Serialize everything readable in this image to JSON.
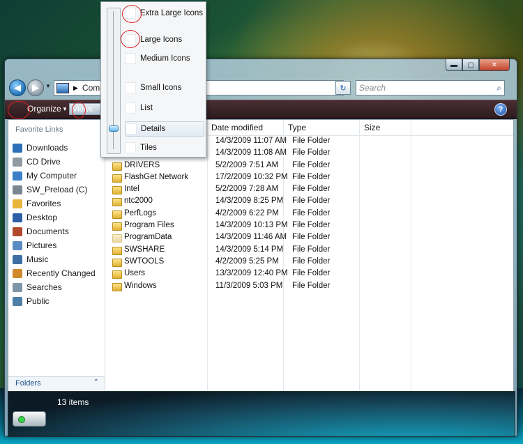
{
  "window": {
    "caption_buttons": {
      "minimize": "▬",
      "maximize": "▢",
      "close": "✕"
    }
  },
  "nav": {
    "address_crumb": "Comp",
    "search_placeholder": "Search"
  },
  "toolbar": {
    "organize_label": "Organize",
    "views_label": "Views",
    "help_label": "?"
  },
  "nav_pane": {
    "heading": "Favorite Links",
    "items": [
      {
        "label": "Downloads",
        "icon": "downloads-icon",
        "color": "#2b6fb8"
      },
      {
        "label": "CD Drive",
        "icon": "cd-drive-icon",
        "color": "#8f9aa3"
      },
      {
        "label": "My Computer",
        "icon": "computer-icon",
        "color": "#3b7fc7"
      },
      {
        "label": "SW_Preload (C)",
        "icon": "hard-drive-icon",
        "color": "#7a8791"
      },
      {
        "label": "Favorites",
        "icon": "star-icon",
        "color": "#e7b53a"
      },
      {
        "label": "Desktop",
        "icon": "desktop-icon",
        "color": "#2d5fa8"
      },
      {
        "label": "Documents",
        "icon": "documents-icon",
        "color": "#b34a2e"
      },
      {
        "label": "Pictures",
        "icon": "pictures-icon",
        "color": "#5a8cc2"
      },
      {
        "label": "Music",
        "icon": "music-icon",
        "color": "#3f6fa5"
      },
      {
        "label": "Recently Changed",
        "icon": "recent-icon",
        "color": "#d08a2c"
      },
      {
        "label": "Searches",
        "icon": "search-icon",
        "color": "#7f95a8"
      },
      {
        "label": "Public",
        "icon": "public-icon",
        "color": "#4d7fa8"
      }
    ],
    "folders_label": "Folders"
  },
  "columns": {
    "date_modified": "Date modified",
    "type": "Type",
    "size": "Size"
  },
  "files": [
    {
      "name": "",
      "date": "14/3/2009 11:07 AM",
      "type": "File Folder",
      "hidden_name": true
    },
    {
      "name": "",
      "date": "14/3/2009 11:08 AM",
      "type": "File Folder",
      "hidden_name": true
    },
    {
      "name": "DRIVERS",
      "date": "5/2/2009 7:51 AM",
      "type": "File Folder"
    },
    {
      "name": "FlashGet Network",
      "date": "17/2/2009 10:32 PM",
      "type": "File Folder"
    },
    {
      "name": "Intel",
      "date": "5/2/2009 7:28 AM",
      "type": "File Folder"
    },
    {
      "name": "ntc2000",
      "date": "14/3/2009 8:25 PM",
      "type": "File Folder"
    },
    {
      "name": "PerfLogs",
      "date": "4/2/2009 6:22 PM",
      "type": "File Folder"
    },
    {
      "name": "Program Files",
      "date": "14/3/2009 10:13 PM",
      "type": "File Folder"
    },
    {
      "name": "ProgramData",
      "date": "14/3/2009 11:46 AM",
      "type": "File Folder",
      "faded": true
    },
    {
      "name": "SWSHARE",
      "date": "14/3/2009 5:14 PM",
      "type": "File Folder"
    },
    {
      "name": "SWTOOLS",
      "date": "4/2/2009 5:25 PM",
      "type": "File Folder"
    },
    {
      "name": "Users",
      "date": "13/3/2009 12:40 PM",
      "type": "File Folder"
    },
    {
      "name": "Windows",
      "date": "11/3/2009 5:03 PM",
      "type": "File Folder"
    }
  ],
  "status": {
    "item_count": "13 items"
  },
  "views_menu": {
    "items": [
      {
        "label": "Extra Large Icons",
        "key": "extra-large-icons"
      },
      {
        "label": "Large Icons",
        "key": "large-icons"
      },
      {
        "label": "Medium Icons",
        "key": "medium-icons"
      },
      {
        "label": "Small Icons",
        "key": "small-icons"
      },
      {
        "label": "List",
        "key": "list"
      },
      {
        "label": "Details",
        "key": "details",
        "selected": true
      },
      {
        "label": "Tiles",
        "key": "tiles"
      }
    ],
    "slider_level": "details"
  }
}
